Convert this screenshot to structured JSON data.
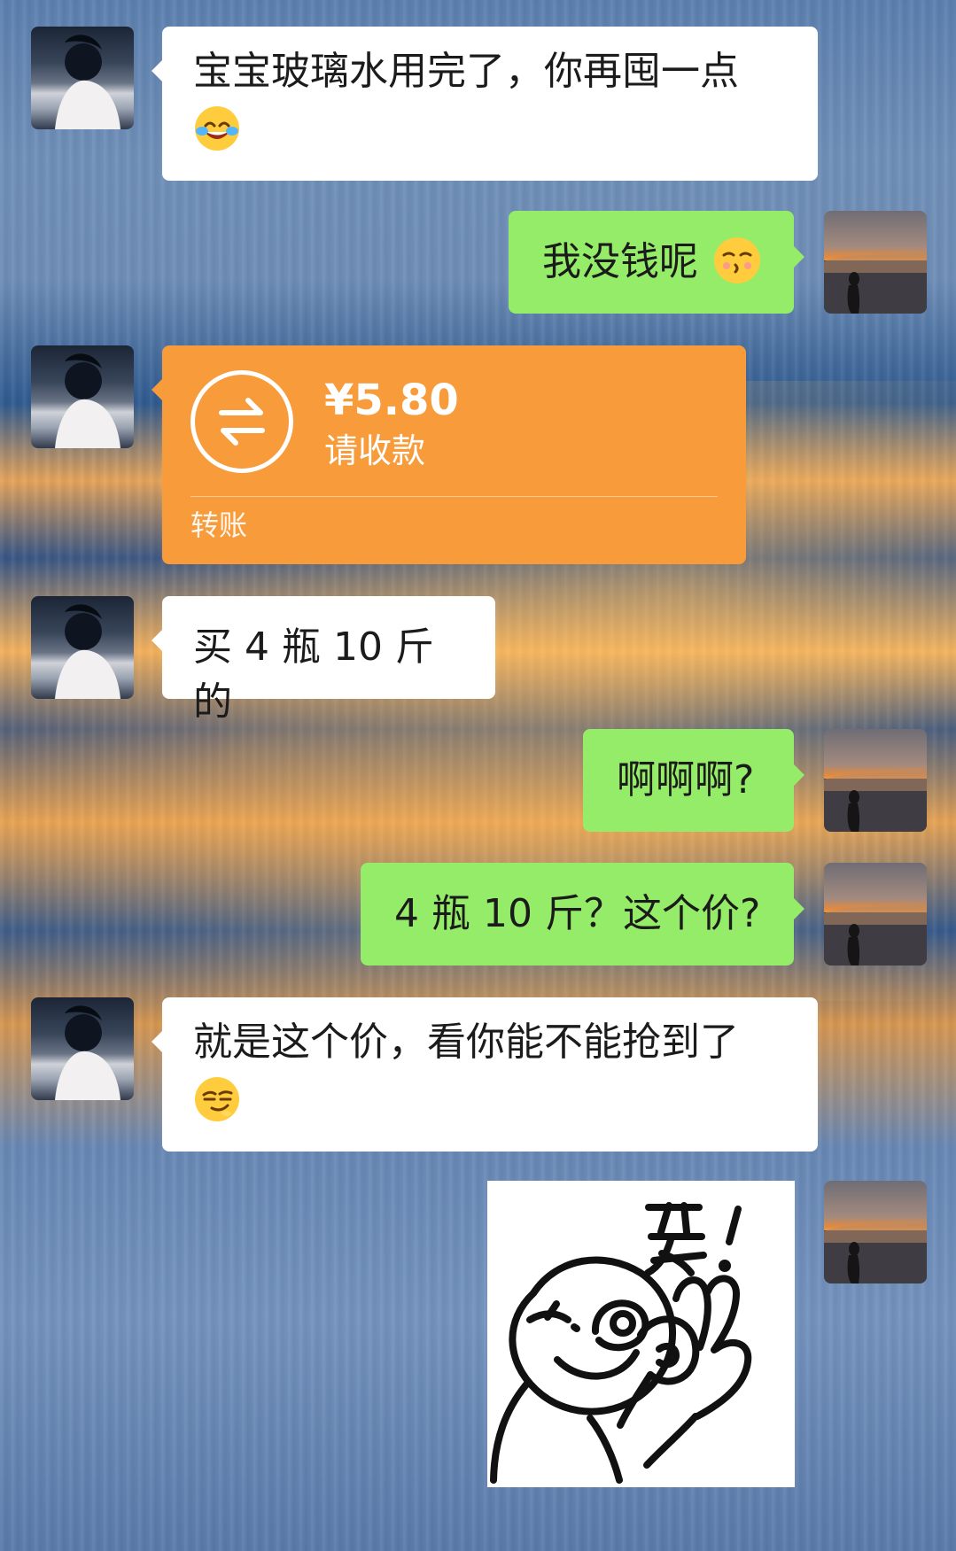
{
  "colors": {
    "incoming_bubble": "#ffffff",
    "outgoing_bubble": "#95ec69",
    "transfer_card": "#f79b3b"
  },
  "messages": [
    {
      "id": "m1",
      "sender": "contact",
      "text": "宝宝玻璃水用完了，你再囤一点",
      "emoji": "face-with-tears-of-joy-icon"
    },
    {
      "id": "m2",
      "sender": "me",
      "text": "我没钱呢",
      "emoji": "kissing-face-with-closed-eyes-icon"
    },
    {
      "id": "m3",
      "sender": "contact",
      "type": "transfer",
      "amount": "¥5.80",
      "status": "请收款",
      "label": "转账"
    },
    {
      "id": "m4",
      "sender": "contact",
      "text": "买 4 瓶 10 斤的"
    },
    {
      "id": "m5",
      "sender": "me",
      "text": "啊啊啊?"
    },
    {
      "id": "m6",
      "sender": "me",
      "text": "4 瓶 10 斤？这个价?"
    },
    {
      "id": "m7",
      "sender": "contact",
      "text": "就是这个价，看你能不能抢到了",
      "emoji": "smirking-face-icon"
    },
    {
      "id": "m8",
      "sender": "me",
      "type": "sticker",
      "sticker_text": "妥!",
      "sticker_icon": "winking-ok-hand-sticker-icon"
    }
  ]
}
